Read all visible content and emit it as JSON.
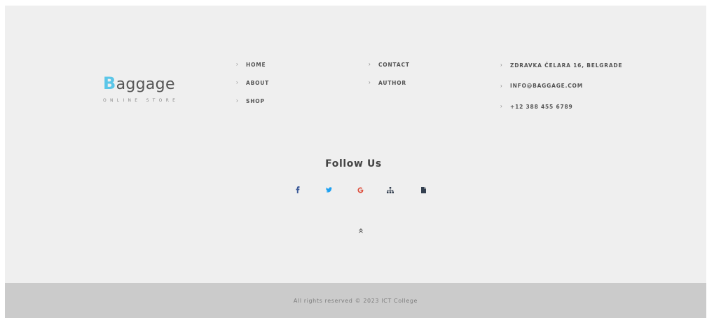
{
  "logo": {
    "initial": "B",
    "rest": "aggage",
    "tagline": "ONLINE STORE",
    "accent_color": "#5bc6e8"
  },
  "nav_col1": [
    {
      "label": "HOME"
    },
    {
      "label": "ABOUT"
    },
    {
      "label": "SHOP"
    }
  ],
  "nav_col2": [
    {
      "label": "CONTACT"
    },
    {
      "label": "AUTHOR"
    }
  ],
  "contact": [
    {
      "label": "ZDRAVKA ČELARA 16, BELGRADE"
    },
    {
      "label": "INFO@BAGGAGE.COM"
    },
    {
      "label": "+12 388 455 6789"
    }
  ],
  "follow": {
    "title": "Follow Us",
    "icons": [
      "facebook-icon",
      "twitter-icon",
      "google-icon",
      "sitemap-icon",
      "document-icon"
    ]
  },
  "copyright": "All rights reserved © 2023 ICT College",
  "colors": {
    "footer_bg": "#efefef",
    "bar_bg": "#cbcbcb",
    "facebook": "#3b5998",
    "twitter": "#1da1f2",
    "google": "#dd4b39",
    "dark_icon": "#333f4f"
  }
}
